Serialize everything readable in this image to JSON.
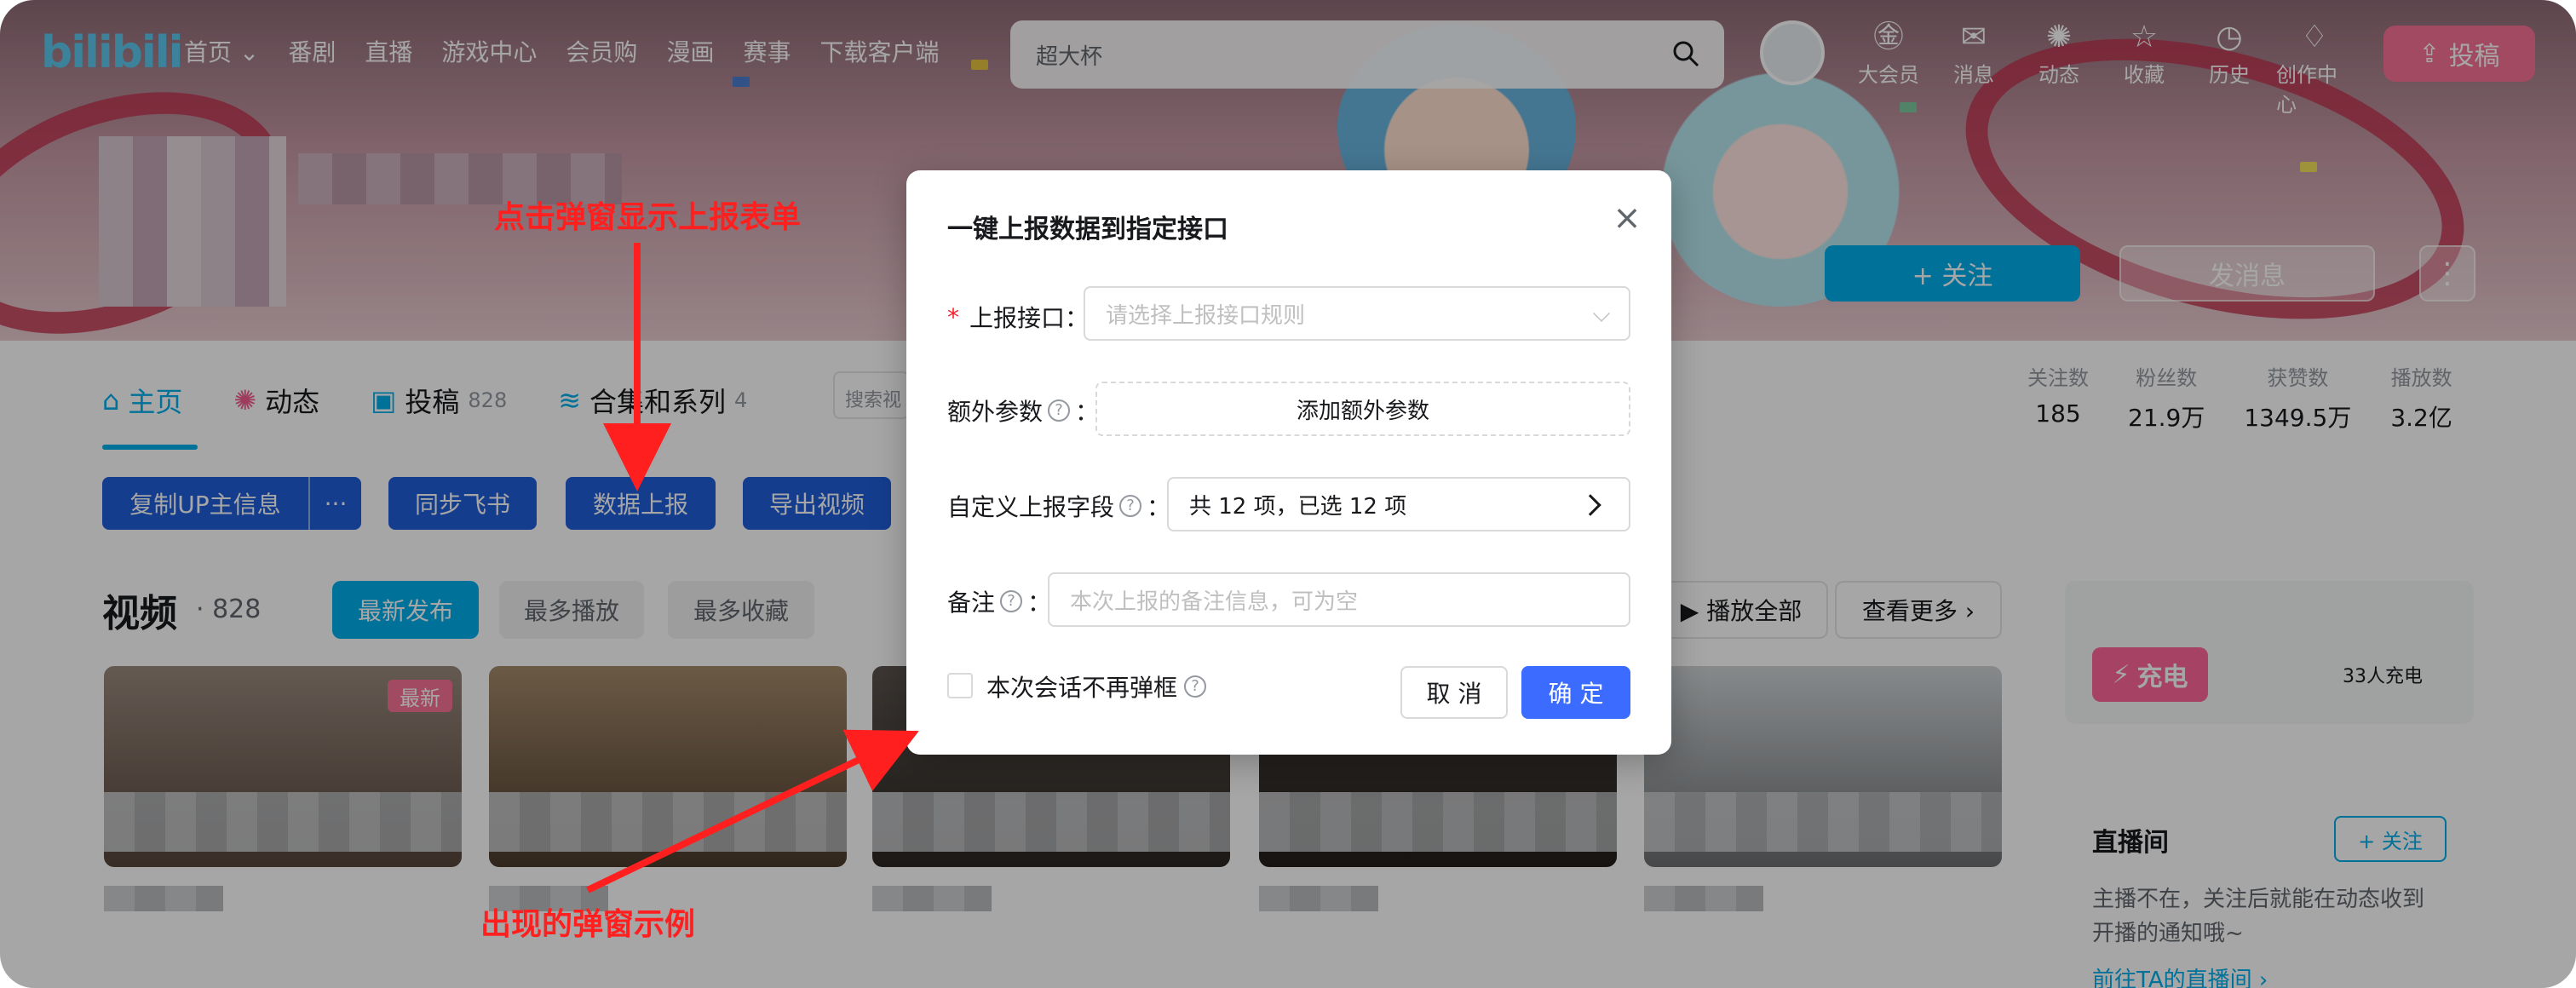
{
  "header": {
    "logo": "bilibili",
    "nav": [
      "首页 ⌄",
      "番剧",
      "直播",
      "游戏中心",
      "会员购",
      "漫画",
      "赛事",
      "下载客户端"
    ],
    "search_placeholder": "超大杯",
    "icons": [
      {
        "icon": "vip-icon",
        "glyph": "㊎",
        "label": "大会员"
      },
      {
        "icon": "message-icon",
        "glyph": "✉",
        "label": "消息"
      },
      {
        "icon": "dynamic-icon",
        "glyph": "✺",
        "label": "动态"
      },
      {
        "icon": "star-icon",
        "glyph": "☆",
        "label": "收藏"
      },
      {
        "icon": "history-icon",
        "glyph": "◷",
        "label": "历史"
      },
      {
        "icon": "bulb-icon",
        "glyph": "♢",
        "label": "创作中心"
      }
    ],
    "upload_label": "投稿"
  },
  "banner": {
    "follow_label": "+ 关注",
    "message_label": "发消息",
    "more_label": "⋮"
  },
  "tabs": [
    {
      "label": "主页",
      "count": ""
    },
    {
      "label": "动态",
      "count": ""
    },
    {
      "label": "投稿",
      "count": "828"
    },
    {
      "label": "合集和系列",
      "count": "4"
    }
  ],
  "mini_search_placeholder": "搜索视",
  "stats": [
    {
      "label": "关注数",
      "value": "185"
    },
    {
      "label": "粉丝数",
      "value": "21.9万"
    },
    {
      "label": "获赞数",
      "value": "1349.5万"
    },
    {
      "label": "播放数",
      "value": "3.2亿"
    }
  ],
  "toolbar": {
    "copy_up": "复制UP主信息",
    "more": "···",
    "sync_feishu": "同步飞书",
    "report": "数据上报",
    "export_video": "导出视频"
  },
  "videos": {
    "title": "视频",
    "count": "· 828",
    "sort": [
      "最新发布",
      "最多播放",
      "最多收藏"
    ],
    "play_all": "▶ 播放全部",
    "see_more": "查看更多 ›",
    "new_tag": "最新"
  },
  "side": {
    "charge_label": "充电",
    "charge_count": "33人充电",
    "live_title": "直播间",
    "live_follow": "+ 关注",
    "live_desc": "主播不在，关注后就能在动态收到开播的通知哦~",
    "live_link": "前往TA的直播间 ›"
  },
  "modal": {
    "title": "一键上报数据到指定接口",
    "close": "×",
    "required_mark": "*",
    "field1_label": "上报接口：",
    "field1_placeholder": "请选择上报接口规则",
    "field2_label": "额外参数",
    "field2_button": "添加额外参数",
    "field3_label": "自定义上报字段",
    "field3_value": "共 12 项，已选 12 项",
    "field4_label": "备注",
    "field4_placeholder": "本次上报的备注信息，可为空",
    "colon": "：",
    "checkbox_label": "本次会话不再弹框",
    "cancel": "取 消",
    "ok": "确 定"
  },
  "annotations": {
    "top": "点击弹窗显示上报表单",
    "bottom": "出现的弹窗示例"
  },
  "colors": {
    "accent": "#00aeec",
    "pink": "#fb7299",
    "toolbar": "#1f5fd9",
    "primary": "#3b6bff",
    "annotation": "#ff1f1f"
  }
}
